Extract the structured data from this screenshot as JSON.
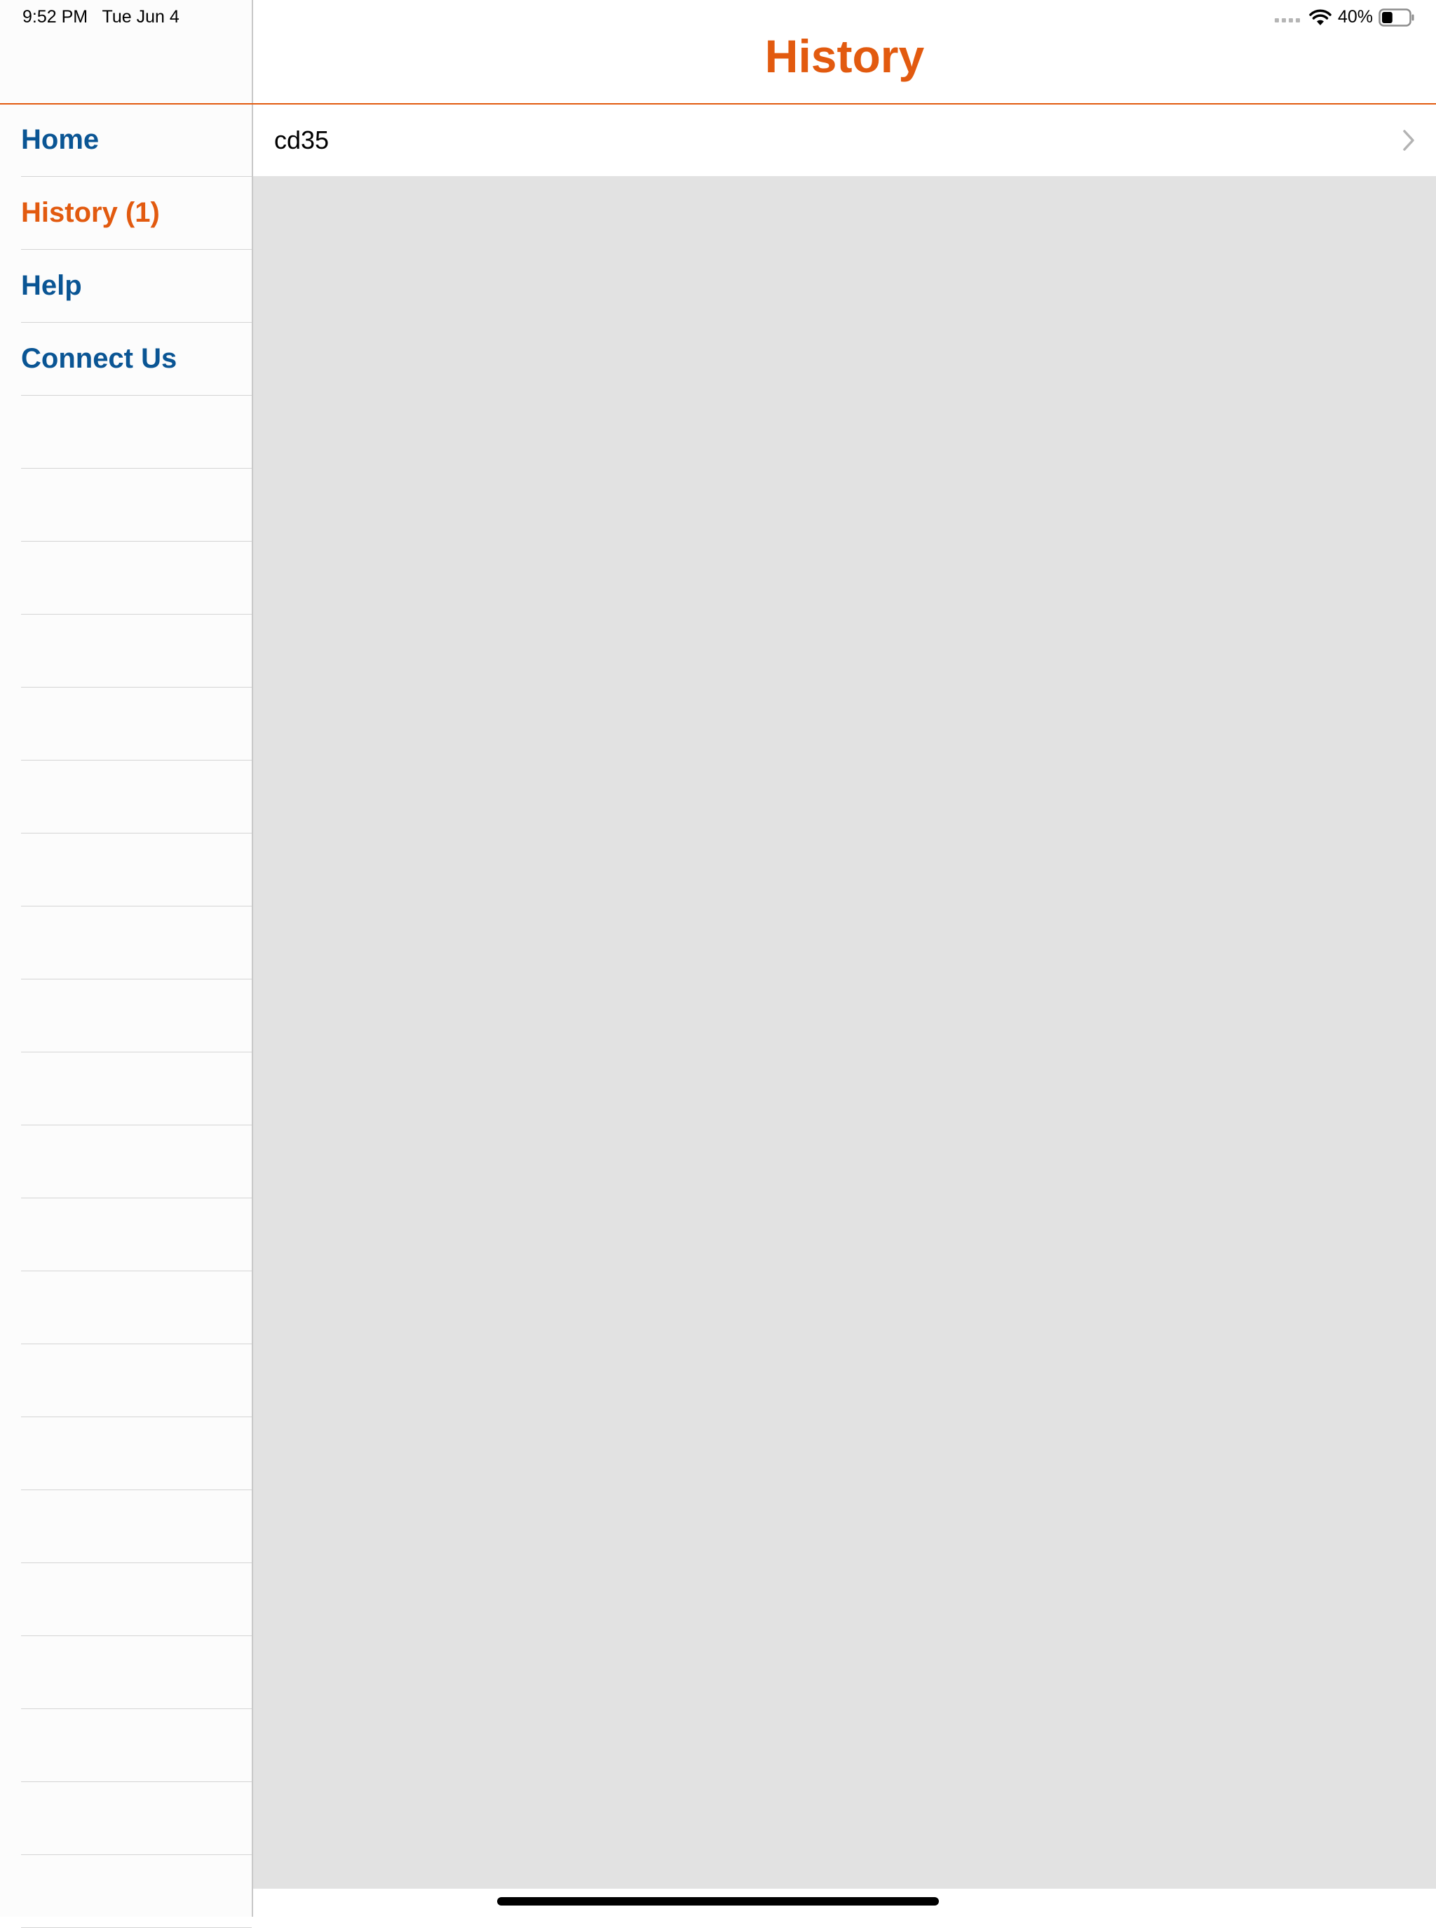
{
  "status_bar": {
    "time": "9:52 PM",
    "date": "Tue Jun 4",
    "battery_percent": "40%",
    "battery_level": 0.4,
    "icons": [
      "cellular-dots-icon",
      "wifi-icon",
      "battery-icon"
    ]
  },
  "navbar": {
    "title": "History"
  },
  "sidebar": {
    "items": [
      {
        "label": "Home",
        "active": false
      },
      {
        "label": "History (1)",
        "active": true
      },
      {
        "label": "Help",
        "active": false
      },
      {
        "label": "Connect Us",
        "active": false
      }
    ],
    "empty_rows": 21
  },
  "history": {
    "items": [
      {
        "label": "cd35"
      }
    ]
  },
  "colors": {
    "accent": "#e25a0f",
    "link": "#0a5594",
    "content_background": "#e2e2e2"
  }
}
